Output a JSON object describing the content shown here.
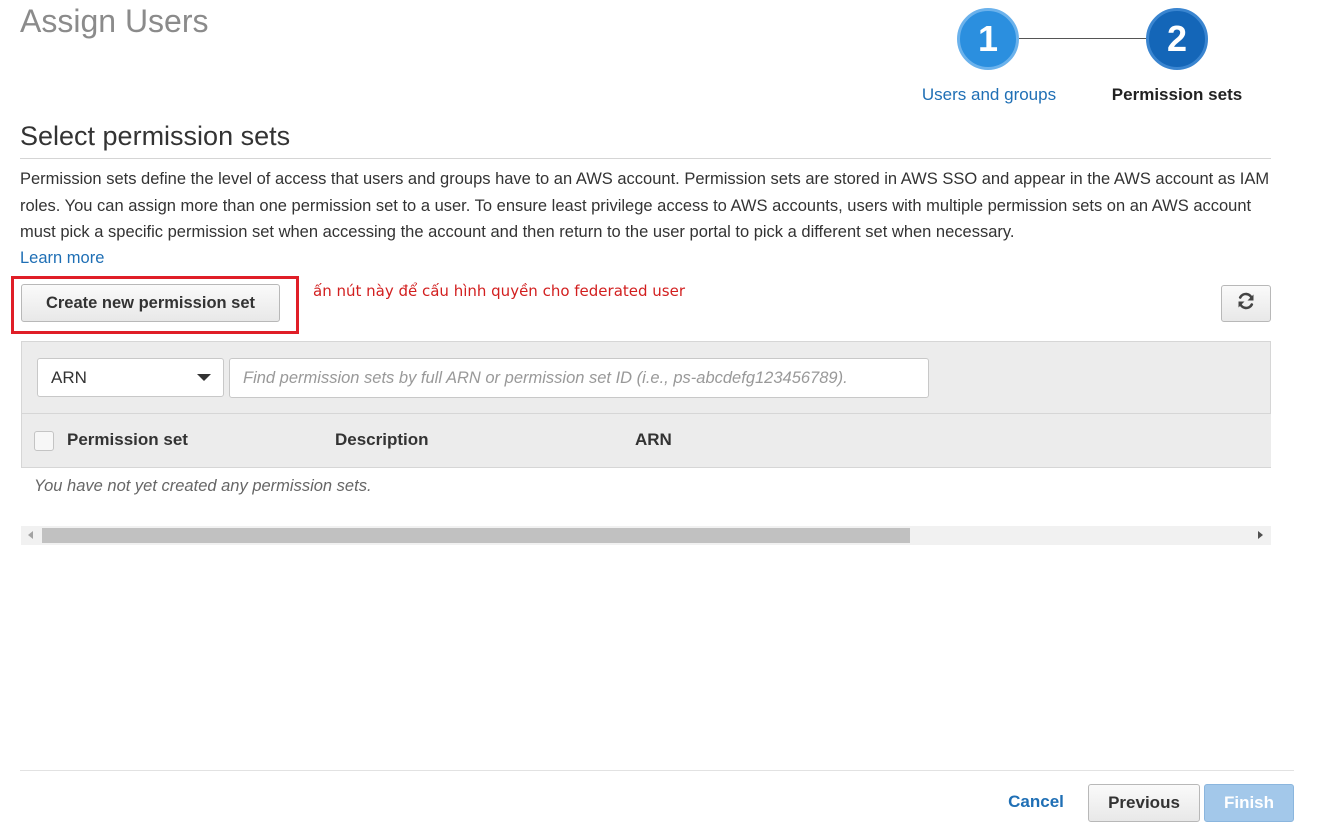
{
  "header": {
    "title": "Assign Users"
  },
  "stepper": {
    "steps": [
      {
        "number": "1",
        "label": "Users and groups"
      },
      {
        "number": "2",
        "label": "Permission sets"
      }
    ]
  },
  "section": {
    "title": "Select permission sets",
    "description": "Permission sets define the level of access that users and groups have to an AWS account. Permission sets are stored in AWS SSO and appear in the AWS account as IAM roles. You can assign more than one permission set to a user. To ensure least privilege access to AWS accounts, users with multiple permission sets on an AWS account must pick a specific permission set when accessing the account and then return to the user portal to pick a different set when necessary.",
    "learn_more": "Learn more"
  },
  "actions": {
    "create_label": "Create new permission set",
    "annotation": "ấn nút này để cấu hình quyền cho federated user",
    "refresh_icon": "refresh-icon"
  },
  "filter": {
    "select_value": "ARN",
    "search_placeholder": "Find permission sets by full ARN or permission set ID (i.e., ps-abcdefg123456789)."
  },
  "table": {
    "columns": [
      "Permission set",
      "Description",
      "ARN"
    ],
    "empty_message": "You have not yet created any permission sets."
  },
  "footer": {
    "cancel_label": "Cancel",
    "previous_label": "Previous",
    "finish_label": "Finish"
  },
  "colors": {
    "accent": "#1f6fb5",
    "step_active": "#1466b8",
    "step_done": "#2b8fdf",
    "highlight": "#e01e27"
  }
}
